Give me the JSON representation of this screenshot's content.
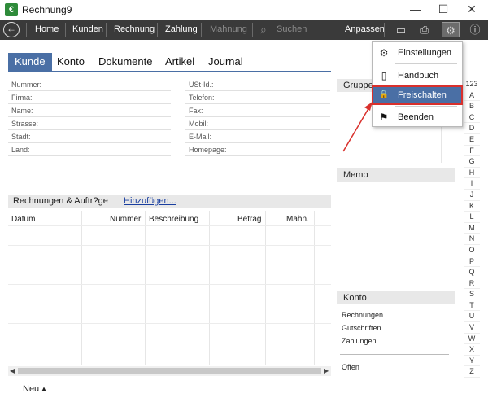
{
  "window": {
    "title": "Rechnung9",
    "app_icon": "€",
    "minimize_icon": "—",
    "maximize_icon": "☐",
    "close_icon": "✕"
  },
  "toolbar": {
    "back_icon": "←",
    "items": [
      "Home",
      "Kunden",
      "Rechnung",
      "Zahlung",
      "Mahnung"
    ],
    "search_label": "Suchen",
    "search_icon": "⌕",
    "customize_label": "Anpassen",
    "window_icon": "▭",
    "print_icon": "⎙",
    "gear_icon": "⚙",
    "info_icon": "ⓘ"
  },
  "tabs": [
    "Kunde",
    "Konto",
    "Dokumente",
    "Artikel",
    "Journal"
  ],
  "customer": {
    "left_fields": [
      "Nummer:",
      "Firma:",
      "Name:",
      "Strasse:",
      "Stadt:",
      "Land:"
    ],
    "right_fields": [
      "USt-Id.:",
      "Telefon:",
      "Fax:",
      "Mobil:",
      "E-Mail:",
      "Homepage:"
    ]
  },
  "invoices": {
    "title": "Rechnungen & Auftr?ge",
    "add_link": "Hinzufügen...",
    "columns": [
      "Datum",
      "Nummer",
      "Beschreibung",
      "Betrag",
      "Mahn."
    ]
  },
  "scroll": {
    "left": "◀",
    "right": "▶"
  },
  "bottom": {
    "new_label": "Neu ▴"
  },
  "groups": {
    "title": "Gruppe"
  },
  "memo": {
    "title": "Memo"
  },
  "account": {
    "title": "Konto",
    "rows": [
      "Rechnungen",
      "Gutschriften",
      "Zahlungen"
    ],
    "open_label": "Offen"
  },
  "alphabet": [
    "123",
    "A",
    "B",
    "C",
    "D",
    "E",
    "F",
    "G",
    "H",
    "I",
    "J",
    "K",
    "L",
    "M",
    "N",
    "O",
    "P",
    "Q",
    "R",
    "S",
    "T",
    "U",
    "V",
    "W",
    "X",
    "Y",
    "Z"
  ],
  "menu": {
    "items": [
      {
        "label": "Einstellungen",
        "icon": "⚙"
      },
      {
        "label": "Handbuch",
        "icon": "▯"
      },
      {
        "label": "Freischalten",
        "icon": "🔒"
      },
      {
        "label": "Beenden",
        "icon": "⚑"
      }
    ]
  },
  "colors": {
    "accent": "#4a6fa5",
    "toolbar": "#3a3a3a",
    "annotation": "#d9302c"
  }
}
